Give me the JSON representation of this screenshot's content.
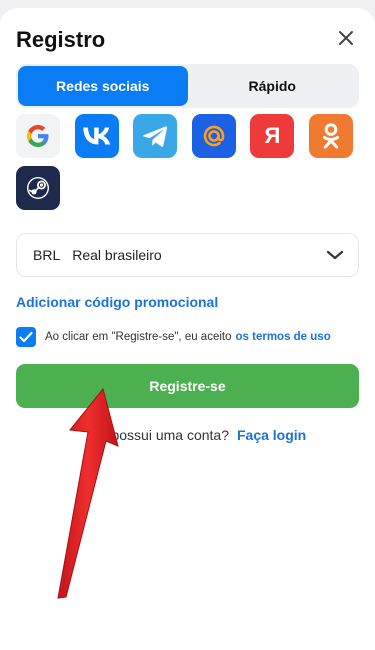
{
  "dialog": {
    "title": "Registro"
  },
  "tabs": [
    {
      "label": "Redes sociais",
      "active": true
    },
    {
      "label": "Rápido",
      "active": false
    }
  ],
  "social": [
    {
      "name": "google",
      "icon": "google-icon",
      "glyph": "G",
      "bg": "#f2f3f5"
    },
    {
      "name": "vk",
      "icon": "vk-icon",
      "glyph": "VK",
      "bg": "#0a7cf4"
    },
    {
      "name": "telegram",
      "icon": "telegram-icon",
      "glyph": "",
      "bg": "#3aa8e6"
    },
    {
      "name": "mailru",
      "icon": "at-sign-icon",
      "glyph": "@",
      "bg": "#1b61e4"
    },
    {
      "name": "yandex",
      "icon": "yandex-icon",
      "glyph": "Я",
      "bg": "#ee3a3a"
    },
    {
      "name": "odnoklassniki",
      "icon": "odnoklassniki-icon",
      "glyph": "",
      "bg": "#f07a2f"
    },
    {
      "name": "steam",
      "icon": "steam-icon",
      "glyph": "",
      "bg": "#1d2a4c"
    }
  ],
  "currency": {
    "code": "BRL",
    "name": "Real brasileiro"
  },
  "promo": {
    "label": "Adicionar código promocional"
  },
  "terms": {
    "checked": true,
    "text": "Ao clicar em \"Registre-se\", eu aceito",
    "link": "os termos de uso"
  },
  "register": {
    "label": "Registre-se"
  },
  "login": {
    "question": "Já possui uma conta?",
    "link": "Faça login"
  },
  "colors": {
    "accent": "#0a7cf4",
    "register": "#4caf50",
    "link": "#1a73d8",
    "annotation_arrow": "#e8262c"
  }
}
